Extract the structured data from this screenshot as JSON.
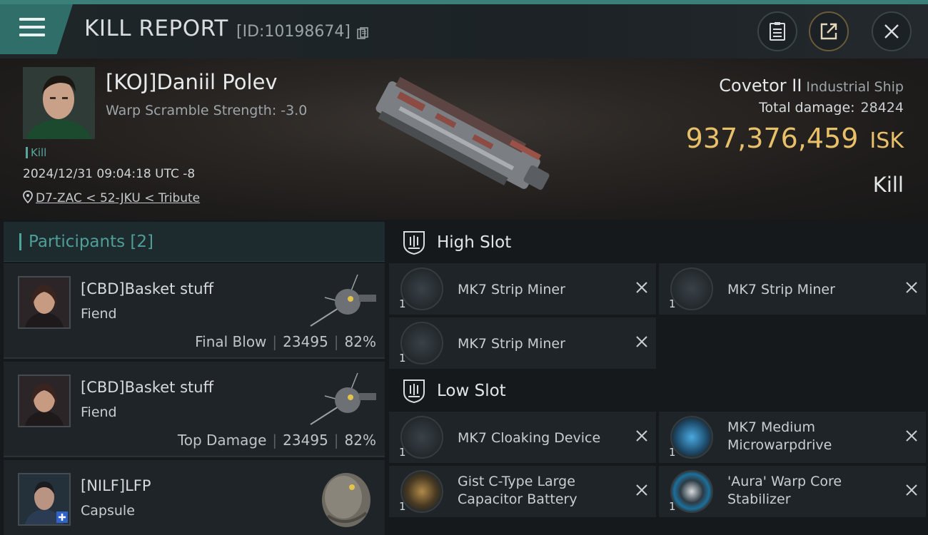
{
  "header": {
    "title": "KILL REPORT",
    "report_id": "[ID:10198674]"
  },
  "victim": {
    "name": "[KOJ]Daniil Polev",
    "warp_scramble": "Warp Scramble Strength: -3.0",
    "kill_tag": "Kill",
    "timestamp": "2024/12/31 09:04:18 UTC -8",
    "location": "D7-ZAC < 52-JKU < Tribute",
    "ship_name": "Covetor II",
    "ship_class": "Industrial Ship",
    "total_damage_label": "Total damage:",
    "total_damage": "28424",
    "isk_value": "937,376,459",
    "isk_unit": "ISK",
    "result": "Kill"
  },
  "participants": {
    "title": "Participants [2]",
    "items": [
      {
        "name": "[CBD]Basket stuff",
        "ship": "Fiend",
        "role": "Final Blow",
        "damage": "23495",
        "percent": "82%"
      },
      {
        "name": "[CBD]Basket stuff",
        "ship": "Fiend",
        "role": "Top Damage",
        "damage": "23495",
        "percent": "82%"
      },
      {
        "name": "[NILF]LFP",
        "ship": "Capsule"
      }
    ]
  },
  "fitting": {
    "high_slot": {
      "title": "High Slot",
      "modules": [
        {
          "name": "MK7 Strip Miner",
          "qty": "1",
          "icon": "strip-miner-icon"
        },
        {
          "name": "MK7 Strip Miner",
          "qty": "1",
          "icon": "strip-miner-icon"
        },
        {
          "name": "MK7 Strip Miner",
          "qty": "1",
          "icon": "strip-miner-icon"
        }
      ]
    },
    "low_slot": {
      "title": "Low Slot",
      "modules": [
        {
          "name": "MK7 Cloaking Device",
          "qty": "1",
          "icon": "cloaking-device-icon"
        },
        {
          "name": "MK7 Medium Microwarpdrive",
          "qty": "1",
          "icon": "microwarpdrive-icon"
        },
        {
          "name": "Gist C-Type Large Capacitor Battery",
          "qty": "1",
          "icon": "capacitor-battery-icon"
        },
        {
          "name": "'Aura' Warp Core Stabilizer",
          "qty": "1",
          "icon": "warp-core-stabilizer-icon"
        }
      ]
    }
  },
  "colors": {
    "accent_teal": "#4fa59c",
    "isk_gold": "#e8c06a",
    "panel_bg": "#1e2427"
  }
}
